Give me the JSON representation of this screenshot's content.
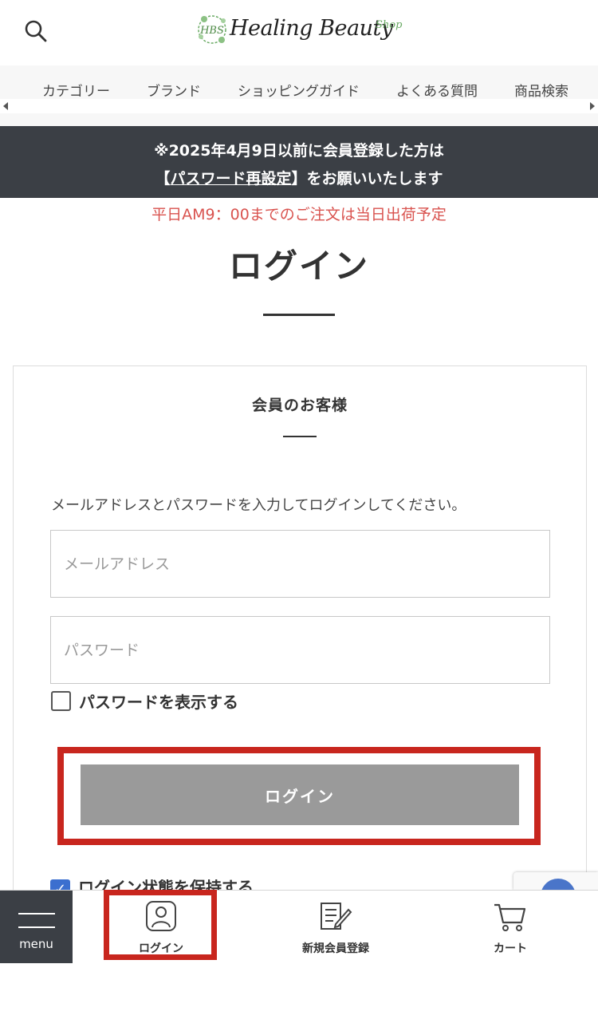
{
  "header": {
    "logo_text": "Healing Beauty",
    "logo_sub": "Shop",
    "logo_emblem": "HBS",
    "search_icon": "search-icon"
  },
  "nav": {
    "items": [
      "カテゴリー",
      "ブランド",
      "ショッピングガイド",
      "よくある質問",
      "商品検索"
    ]
  },
  "notice": {
    "line1": "※2025年4月9日以前に会員登録した方は",
    "bracket_open": "【",
    "link": "パスワード再設定",
    "bracket_close": "】",
    "line2_rest": "をお願いいたします"
  },
  "shipping_note": "平日AM9：00までのご注文は当日出荷予定",
  "page_title": "ログイン",
  "member_section": {
    "title": "会員のお客様",
    "instructions": "メールアドレスとパスワードを入力してログインしてください。",
    "email_placeholder": "メールアドレス",
    "password_placeholder": "パスワード",
    "show_password_label": "パスワードを表示する",
    "login_button": "ログイン",
    "remember_label": "ログイン状態を保持する",
    "remember_checked": true
  },
  "bottom_bar": {
    "menu_label": "menu",
    "login_label": "ログイン",
    "register_label": "新規会員登録",
    "cart_label": "カート"
  },
  "colors": {
    "highlight": "#c8261e",
    "notice_bg": "#3b3f45",
    "shipping_text": "#d9534f",
    "button_bg": "#9a9a9a",
    "logo_green": "#6aaa64"
  }
}
